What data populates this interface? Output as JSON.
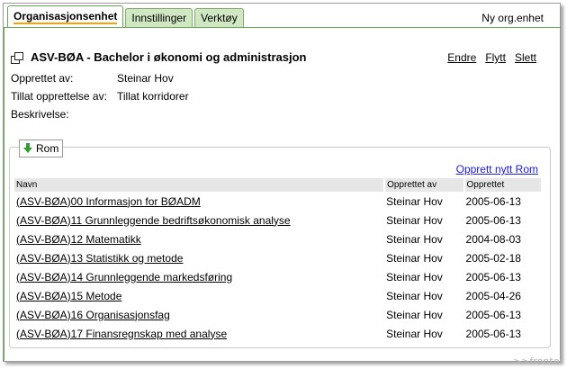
{
  "tabs": [
    {
      "label": "Organisasjonsenhet",
      "active": true
    },
    {
      "label": "Innstillinger",
      "active": false
    },
    {
      "label": "Verktøy",
      "active": false
    }
  ],
  "header_link": "Ny org.enhet",
  "unit": {
    "icon": "org-unit-icon",
    "title": "ASV-BØA - Bachelor i økonomi og administrasjon",
    "actions": [
      "Endre",
      "Flytt",
      "Slett"
    ]
  },
  "info": [
    {
      "label": "Opprettet av:",
      "value": "Steinar Hov"
    },
    {
      "label": "Tillat opprettelse av:",
      "value": "Tillat korridorer"
    },
    {
      "label": "Beskrivelse:",
      "value": ""
    }
  ],
  "rooms": {
    "legend": "Rom",
    "legend_icon": "down-arrow-icon",
    "new_link": "Opprett nytt Rom",
    "columns": [
      "Navn",
      "Opprettet av",
      "Opprettet"
    ],
    "rows": [
      {
        "name": "(ASV-BØA)00 Informasjon for BØADM",
        "by": "Steinar Hov",
        "date": "2005-06-13"
      },
      {
        "name": "(ASV-BØA)11 Grunnleggende bedriftsøkonomisk analyse",
        "by": "Steinar Hov",
        "date": "2005-06-13"
      },
      {
        "name": "(ASV-BØA)12 Matematikk",
        "by": "Steinar Hov",
        "date": "2004-08-03"
      },
      {
        "name": "(ASV-BØA)13 Statistikk og metode",
        "by": "Steinar Hov",
        "date": "2005-02-18"
      },
      {
        "name": "(ASV-BØA)14 Grunnleggende markedsføring",
        "by": "Steinar Hov",
        "date": "2005-06-13"
      },
      {
        "name": "(ASV-BØA)15 Metode",
        "by": "Steinar Hov",
        "date": "2005-04-26"
      },
      {
        "name": "(ASV-BØA)16 Organisasjonsfag",
        "by": "Steinar Hov",
        "date": "2005-06-13"
      },
      {
        "name": "(ASV-BØA)17 Finansregnskap med analyse",
        "by": "Steinar Hov",
        "date": "2005-06-13"
      }
    ]
  },
  "watermark": ">>fronter",
  "colors": {
    "tab_border": "#6aa358",
    "tab_bg": "#cfe8c1",
    "active_underline": "#ffa200",
    "link_blue": "#1a1ae0"
  }
}
